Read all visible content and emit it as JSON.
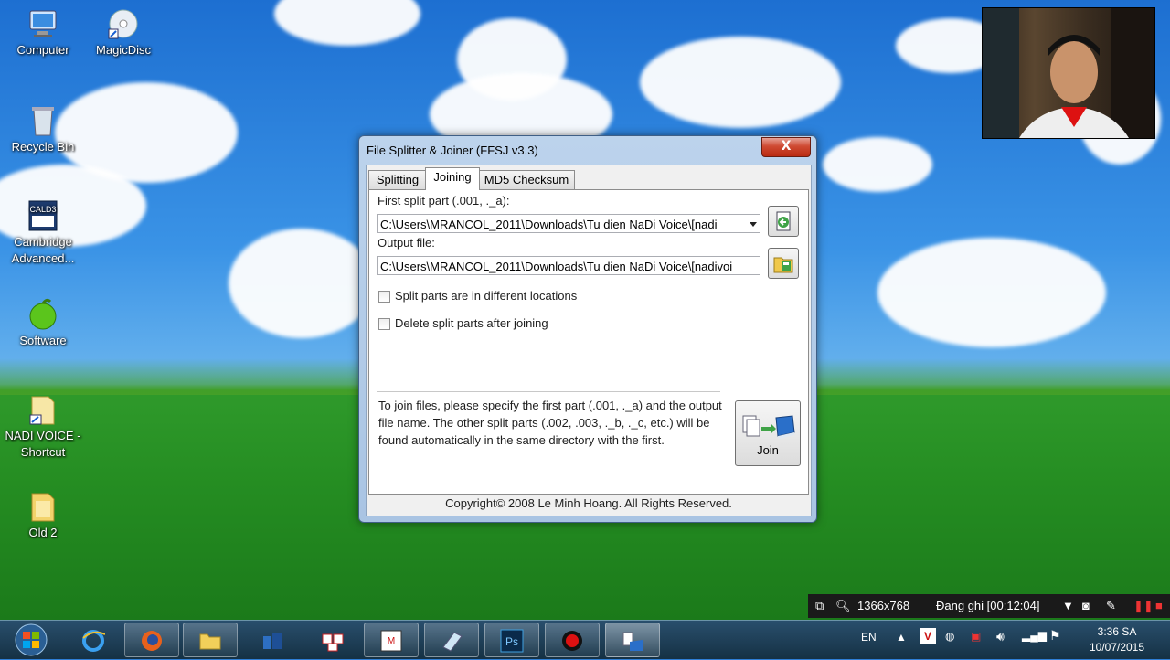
{
  "desktop": {
    "icons": [
      {
        "label": "Computer"
      },
      {
        "label": "MagicDisc"
      },
      {
        "label": "Recycle Bin"
      },
      {
        "label": "Cambridge Advanced..."
      },
      {
        "label": "Software"
      },
      {
        "label": "NADI VOICE - Shortcut"
      },
      {
        "label": "Old 2"
      }
    ]
  },
  "window": {
    "title": "File Splitter & Joiner (FFSJ v3.3)",
    "close_label": "X",
    "tabs": [
      {
        "label": "Splitting"
      },
      {
        "label": "Joining",
        "active": true
      },
      {
        "label": "MD5 Checksum"
      }
    ],
    "first_part_label": "First split part (.001, ._a):",
    "first_part_value": "C:\\Users\\MRANCOL_2011\\Downloads\\Tu dien NaDi Voice\\[nadi",
    "output_label": "Output file:",
    "output_value": "C:\\Users\\MRANCOL_2011\\Downloads\\Tu dien NaDi Voice\\[nadivoi",
    "options": [
      {
        "label": "Split parts are in different locations",
        "checked": false
      },
      {
        "label": "Delete split parts after joining",
        "checked": false
      }
    ],
    "hint": "To join files, please specify the first part (.001, ._a) and the output file name. The other split parts (.002, .003, ._b, ._c, etc.) will be found automatically in the same directory with the first.",
    "join_label": "Join",
    "copyright": "Copyright© 2008 Le Minh Hoang. All Rights Reserved."
  },
  "recorder": {
    "resolution": "1366x768",
    "status": "Đang ghi [00:12:04]"
  },
  "taskbar": {
    "language": "EN",
    "time": "3:36 SA",
    "date": "10/07/2015"
  },
  "colors": {
    "accent": "#3f5f86",
    "close": "#c8371c",
    "taskbar": "#1f3d50"
  }
}
